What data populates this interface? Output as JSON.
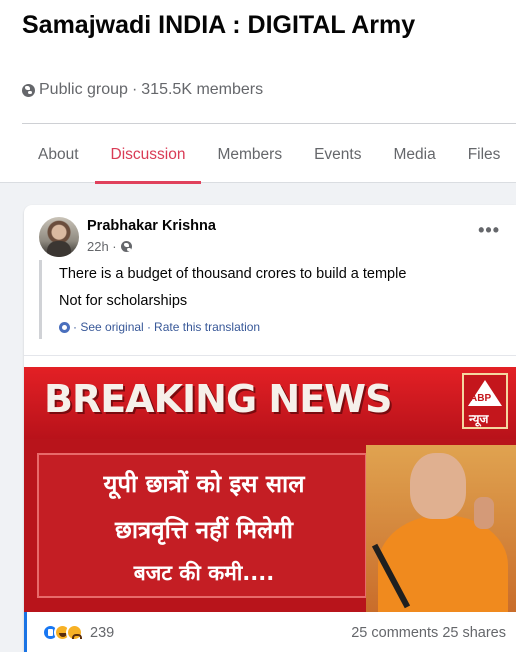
{
  "group": {
    "title": "Samajwadi INDIA : DIGITAL Army",
    "privacy": "Public group",
    "members": "315.5K members"
  },
  "tabs": [
    "About",
    "Discussion",
    "Members",
    "Events",
    "Media",
    "Files"
  ],
  "active_tab": "Discussion",
  "post": {
    "author": "Prabhakar Krishna",
    "time": "22h ·",
    "line1": "There is a budget of thousand crores to build a temple",
    "line2": "Not for scholarships",
    "see_original": "· See original ·",
    "rate_translation": "Rate this translation",
    "image": {
      "banner": "BREAKING NEWS",
      "logo": "ABP",
      "logo_sub": "न्यूज",
      "headline1": "यूपी छात्रों को इस साल",
      "headline2": "छात्रवृत्ति नहीं मिलेगी",
      "headline3": "बजट की कमी...."
    },
    "reaction_count": "239",
    "comments": "25 comments",
    "shares": "25 shares"
  },
  "colors": {
    "accent": "#e0415c",
    "link": "#385898",
    "news_red": "#b8141b"
  }
}
